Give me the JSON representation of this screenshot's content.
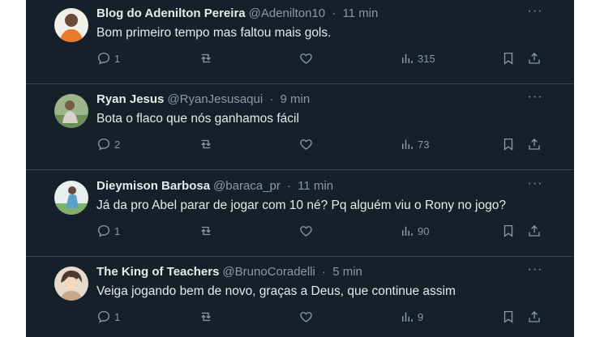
{
  "tweets": [
    {
      "name": "Blog do Adenilton Pereira",
      "handle": "@Adenilton10",
      "sep": "·",
      "time": "11 min",
      "text": "Bom primeiro tempo mas faltou mais gols.",
      "replies": "1",
      "reposts": "",
      "likes": "",
      "views": "315",
      "avatar_color": "#e97b2a"
    },
    {
      "name": "Ryan Jesus",
      "handle": "@RyanJesusaqui",
      "sep": "·",
      "time": "9 min",
      "text": "Bota o flaco que nós ganhamos fácil",
      "replies": "2",
      "reposts": "",
      "likes": "",
      "views": "73",
      "avatar_color": "#6b8e5a"
    },
    {
      "name": "Dieymison Barbosa",
      "handle": "@baraca_pr",
      "sep": "·",
      "time": "11 min",
      "text": "Já da pro Abel parar de jogar com 10 né? Pq alguém viu o Rony no jogo?",
      "replies": "1",
      "reposts": "",
      "likes": "",
      "views": "90",
      "avatar_color": "#5aa0c8"
    },
    {
      "name": "The King of Teachers",
      "handle": "@BrunoCoradelli",
      "sep": "·",
      "time": "5 min",
      "text": "Veiga jogando bem de novo, graças a Deus, que continue assim",
      "replies": "1",
      "reposts": "",
      "likes": "",
      "views": "9",
      "avatar_color": "#c9a98a"
    }
  ],
  "icons": {
    "reply": "reply-icon",
    "repost": "repost-icon",
    "like": "like-icon",
    "views": "views-icon",
    "bookmark": "bookmark-icon",
    "share": "share-icon",
    "more": "more-icon"
  },
  "more_label": "···"
}
